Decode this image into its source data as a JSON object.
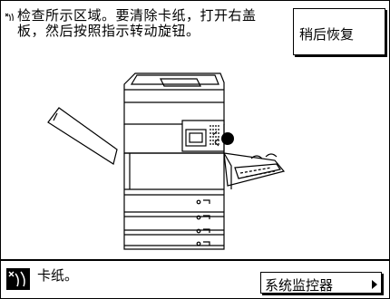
{
  "main": {
    "instruction": "检查所示区域。要清除卡纸，打开右盖\n板，然后按照指示转动旋钮。",
    "later_button_label": "稍后恢复"
  },
  "status_bar": {
    "message": "卡纸。",
    "monitor_button_label": "系统监控器"
  },
  "icons": {
    "top_left": "paper-jam-icon",
    "status": "paper-jam-icon",
    "monitor_arrow": "triangle-right-icon"
  }
}
